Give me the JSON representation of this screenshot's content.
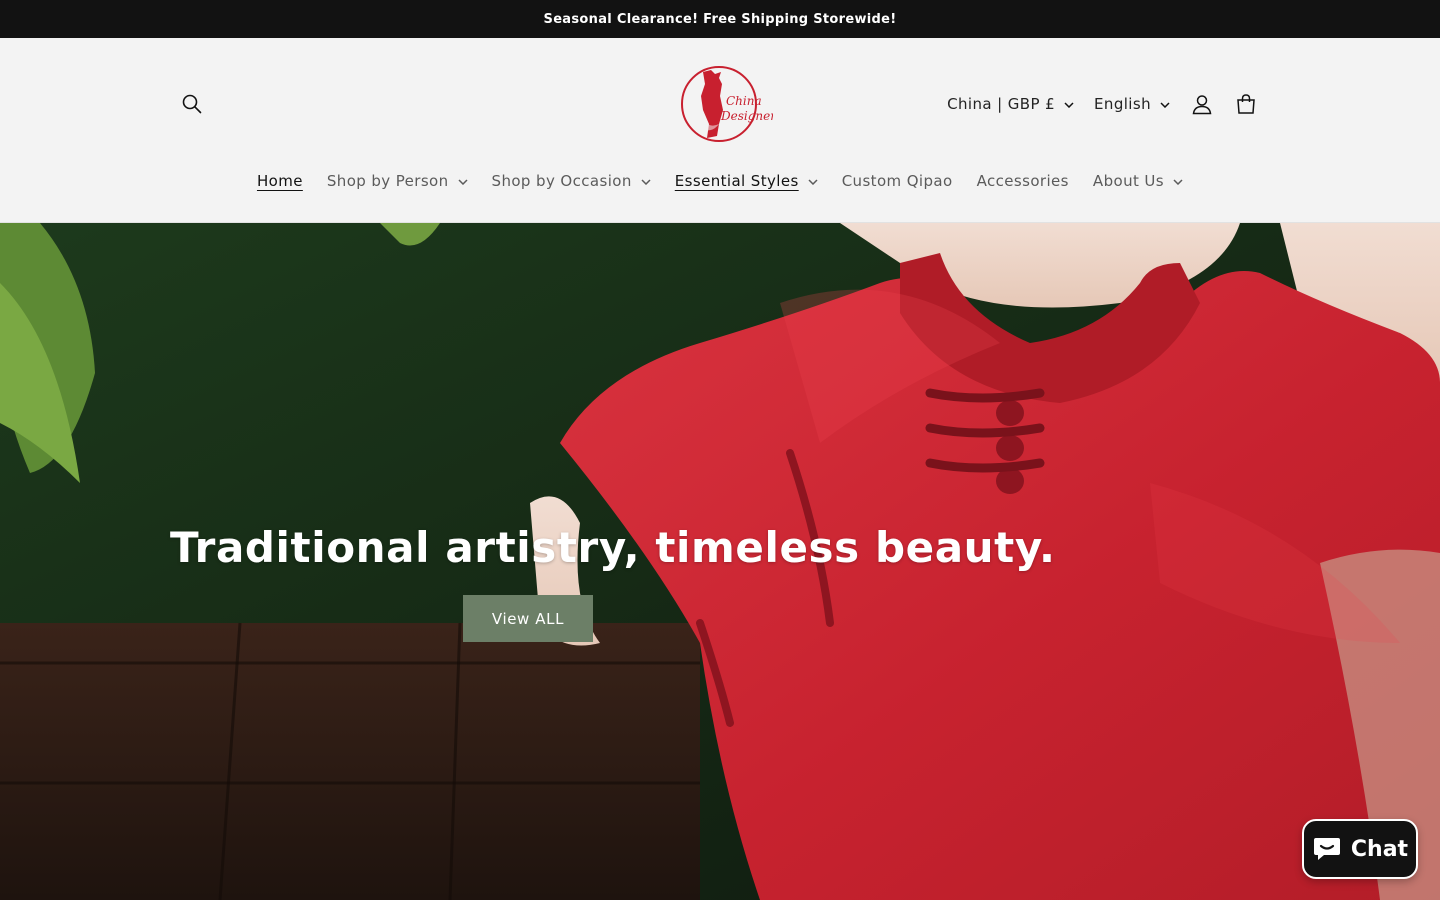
{
  "announcement": {
    "text": "Seasonal Clearance! Free Shipping Storewide!"
  },
  "header": {
    "logo": {
      "line1": "China",
      "line2": "Designer",
      "color": "#c8202f"
    },
    "country_selector": "China | GBP £",
    "language_selector": "English",
    "icons": {
      "search": "search-icon",
      "account": "account-icon",
      "cart": "cart-icon",
      "chevron": "chevron-down-icon"
    }
  },
  "nav": {
    "items": [
      {
        "label": "Home",
        "dropdown": false,
        "active": true
      },
      {
        "label": "Shop by Person",
        "dropdown": true
      },
      {
        "label": "Shop by Occasion",
        "dropdown": true
      },
      {
        "label": "Essential Styles",
        "dropdown": true,
        "underlined": true
      },
      {
        "label": "Custom Qipao",
        "dropdown": false
      },
      {
        "label": "Accessories",
        "dropdown": false
      },
      {
        "label": "About Us",
        "dropdown": true
      }
    ]
  },
  "hero": {
    "title": "Traditional artistry, timeless beauty.",
    "button_label": "View ALL",
    "button_color": "#6c7f67"
  },
  "chat": {
    "label": "Chat",
    "icon": "chat-bubble-icon"
  },
  "colors": {
    "announcement_bg": "#121212",
    "header_bg": "#f3f3f3",
    "accent_red": "#c8202f"
  }
}
